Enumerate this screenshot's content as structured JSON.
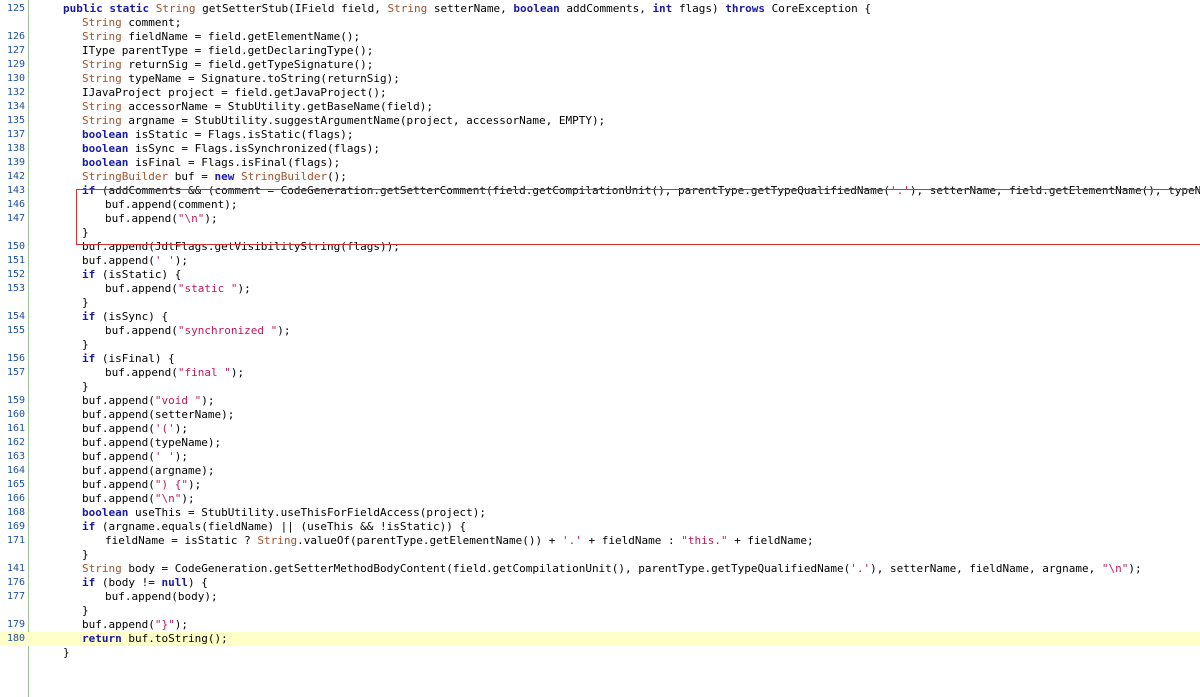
{
  "editor": {
    "highlighted_line": "180",
    "lines": [
      {
        "n": "125",
        "ind": 0,
        "segs": [
          [
            "kw",
            "public static "
          ],
          [
            "ty",
            "String "
          ],
          [
            "",
            "getSetterStub(IField field, "
          ],
          [
            "ty",
            "String "
          ],
          [
            "",
            "setterName, "
          ],
          [
            "kw",
            "boolean "
          ],
          [
            "",
            "addComments, "
          ],
          [
            "kw",
            "int "
          ],
          [
            "",
            "flags) "
          ],
          [
            "kw",
            "throws "
          ],
          [
            "",
            "CoreException {"
          ]
        ]
      },
      {
        "n": "",
        "ind": 1,
        "segs": [
          [
            "ty",
            "String "
          ],
          [
            "",
            "comment;"
          ]
        ]
      },
      {
        "n": "126",
        "ind": 1,
        "segs": [
          [
            "ty",
            "String "
          ],
          [
            "",
            "fieldName = field.getElementName();"
          ]
        ]
      },
      {
        "n": "127",
        "ind": 1,
        "segs": [
          [
            "",
            "IType parentType = field.getDeclaringType();"
          ]
        ]
      },
      {
        "n": "129",
        "ind": 1,
        "segs": [
          [
            "ty",
            "String "
          ],
          [
            "",
            "returnSig = field.getTypeSignature();"
          ]
        ]
      },
      {
        "n": "130",
        "ind": 1,
        "segs": [
          [
            "ty",
            "String "
          ],
          [
            "",
            "typeName = Signature.toString(returnSig);"
          ]
        ]
      },
      {
        "n": "132",
        "ind": 1,
        "segs": [
          [
            "",
            "IJavaProject project = field.getJavaProject();"
          ]
        ]
      },
      {
        "n": "134",
        "ind": 1,
        "segs": [
          [
            "ty",
            "String "
          ],
          [
            "",
            "accessorName = StubUtility.getBaseName(field);"
          ]
        ]
      },
      {
        "n": "135",
        "ind": 1,
        "segs": [
          [
            "ty",
            "String "
          ],
          [
            "",
            "argname = StubUtility.suggestArgumentName(project, accessorName, EMPTY);"
          ]
        ]
      },
      {
        "n": "137",
        "ind": 1,
        "segs": [
          [
            "kw",
            "boolean "
          ],
          [
            "",
            "isStatic = Flags.isStatic(flags);"
          ]
        ]
      },
      {
        "n": "138",
        "ind": 1,
        "segs": [
          [
            "kw",
            "boolean "
          ],
          [
            "",
            "isSync = Flags.isSynchronized(flags);"
          ]
        ]
      },
      {
        "n": "139",
        "ind": 1,
        "segs": [
          [
            "kw",
            "boolean "
          ],
          [
            "",
            "isFinal = Flags.isFinal(flags);"
          ]
        ]
      },
      {
        "n": "142",
        "ind": 1,
        "segs": [
          [
            "ty",
            "StringBuilder "
          ],
          [
            "",
            "buf = "
          ],
          [
            "kw",
            "new "
          ],
          [
            "ty",
            "StringBuilder"
          ],
          [
            "",
            "();"
          ]
        ]
      },
      {
        "n": "143",
        "ind": 1,
        "segs": [
          [
            "kw",
            "if "
          ],
          [
            "",
            "(addComments && (comment = CodeGeneration.getSetterComment(field.getCompilationUnit(), parentType.getTypeQualifiedName("
          ],
          [
            "st",
            "'.'"
          ],
          [
            "",
            "), setterName, field.getElementName(), typeName,"
          ]
        ]
      },
      {
        "n": "146",
        "ind": 2,
        "segs": [
          [
            "",
            "buf.append(comment);"
          ]
        ]
      },
      {
        "n": "147",
        "ind": 2,
        "segs": [
          [
            "",
            "buf.append("
          ],
          [
            "st",
            "\"\\n\""
          ],
          [
            "",
            ");"
          ]
        ]
      },
      {
        "n": "",
        "ind": 1,
        "segs": [
          [
            "",
            "}"
          ]
        ]
      },
      {
        "n": "150",
        "ind": 1,
        "segs": [
          [
            "",
            "buf.append(JdtFlags.getVisibilityString(flags));"
          ]
        ]
      },
      {
        "n": "151",
        "ind": 1,
        "segs": [
          [
            "",
            "buf.append("
          ],
          [
            "st",
            "' '"
          ],
          [
            "",
            ");"
          ]
        ]
      },
      {
        "n": "152",
        "ind": 1,
        "segs": [
          [
            "kw",
            "if "
          ],
          [
            "",
            "(isStatic) {"
          ]
        ]
      },
      {
        "n": "153",
        "ind": 2,
        "segs": [
          [
            "",
            "buf.append("
          ],
          [
            "st",
            "\"static \""
          ],
          [
            "",
            ");"
          ]
        ]
      },
      {
        "n": "",
        "ind": 1,
        "segs": [
          [
            "",
            "}"
          ]
        ]
      },
      {
        "n": "154",
        "ind": 1,
        "segs": [
          [
            "kw",
            "if "
          ],
          [
            "",
            "(isSync) {"
          ]
        ]
      },
      {
        "n": "155",
        "ind": 2,
        "segs": [
          [
            "",
            "buf.append("
          ],
          [
            "st",
            "\"synchronized \""
          ],
          [
            "",
            ");"
          ]
        ]
      },
      {
        "n": "",
        "ind": 1,
        "segs": [
          [
            "",
            "}"
          ]
        ]
      },
      {
        "n": "156",
        "ind": 1,
        "segs": [
          [
            "kw",
            "if "
          ],
          [
            "",
            "(isFinal) {"
          ]
        ]
      },
      {
        "n": "157",
        "ind": 2,
        "segs": [
          [
            "",
            "buf.append("
          ],
          [
            "st",
            "\"final \""
          ],
          [
            "",
            ");"
          ]
        ]
      },
      {
        "n": "",
        "ind": 1,
        "segs": [
          [
            "",
            "}"
          ]
        ]
      },
      {
        "n": "159",
        "ind": 1,
        "segs": [
          [
            "",
            "buf.append("
          ],
          [
            "st",
            "\"void \""
          ],
          [
            "",
            ");"
          ]
        ]
      },
      {
        "n": "160",
        "ind": 1,
        "segs": [
          [
            "",
            "buf.append(setterName);"
          ]
        ]
      },
      {
        "n": "161",
        "ind": 1,
        "segs": [
          [
            "",
            "buf.append("
          ],
          [
            "st",
            "'('"
          ],
          [
            "",
            ");"
          ]
        ]
      },
      {
        "n": "162",
        "ind": 1,
        "segs": [
          [
            "",
            "buf.append(typeName);"
          ]
        ]
      },
      {
        "n": "163",
        "ind": 1,
        "segs": [
          [
            "",
            "buf.append("
          ],
          [
            "st",
            "' '"
          ],
          [
            "",
            ");"
          ]
        ]
      },
      {
        "n": "164",
        "ind": 1,
        "segs": [
          [
            "",
            "buf.append(argname);"
          ]
        ]
      },
      {
        "n": "165",
        "ind": 1,
        "segs": [
          [
            "",
            "buf.append("
          ],
          [
            "st",
            "\") {\""
          ],
          [
            "",
            ");"
          ]
        ]
      },
      {
        "n": "166",
        "ind": 1,
        "segs": [
          [
            "",
            "buf.append("
          ],
          [
            "st",
            "\"\\n\""
          ],
          [
            "",
            ");"
          ]
        ]
      },
      {
        "n": "168",
        "ind": 1,
        "segs": [
          [
            "kw",
            "boolean "
          ],
          [
            "",
            "useThis = StubUtility.useThisForFieldAccess(project);"
          ]
        ]
      },
      {
        "n": "169",
        "ind": 1,
        "segs": [
          [
            "kw",
            "if "
          ],
          [
            "",
            "(argname.equals(fieldName) || (useThis && !isStatic)) {"
          ]
        ]
      },
      {
        "n": "171",
        "ind": 2,
        "segs": [
          [
            "",
            "fieldName = isStatic ? "
          ],
          [
            "ty",
            "String"
          ],
          [
            "",
            ".valueOf(parentType.getElementName()) + "
          ],
          [
            "st",
            "'.'"
          ],
          [
            "",
            " + fieldName : "
          ],
          [
            "st",
            "\"this.\""
          ],
          [
            "",
            " + fieldName;"
          ]
        ]
      },
      {
        "n": "",
        "ind": 1,
        "segs": [
          [
            "",
            "}"
          ]
        ]
      },
      {
        "n": "141",
        "ind": 1,
        "segs": [
          [
            "ty",
            "String "
          ],
          [
            "",
            "body = CodeGeneration.getSetterMethodBodyContent(field.getCompilationUnit(), parentType.getTypeQualifiedName("
          ],
          [
            "st",
            "'.'"
          ],
          [
            "",
            "), setterName, fieldName, argname, "
          ],
          [
            "st",
            "\"\\n\""
          ],
          [
            "",
            ");"
          ]
        ]
      },
      {
        "n": "176",
        "ind": 1,
        "segs": [
          [
            "kw",
            "if "
          ],
          [
            "",
            "(body != "
          ],
          [
            "kw",
            "null"
          ],
          [
            "",
            ") {"
          ]
        ]
      },
      {
        "n": "177",
        "ind": 2,
        "segs": [
          [
            "",
            "buf.append(body);"
          ]
        ]
      },
      {
        "n": "",
        "ind": 1,
        "segs": [
          [
            "",
            "}"
          ]
        ]
      },
      {
        "n": "179",
        "ind": 1,
        "segs": [
          [
            "",
            "buf.append("
          ],
          [
            "st",
            "\"}\""
          ],
          [
            "",
            ");"
          ]
        ]
      },
      {
        "n": "180",
        "ind": 1,
        "segs": [
          [
            "kw",
            "return "
          ],
          [
            "",
            "buf.toString();"
          ]
        ]
      },
      {
        "n": "",
        "ind": 0,
        "segs": [
          [
            "",
            "}"
          ]
        ]
      }
    ]
  }
}
